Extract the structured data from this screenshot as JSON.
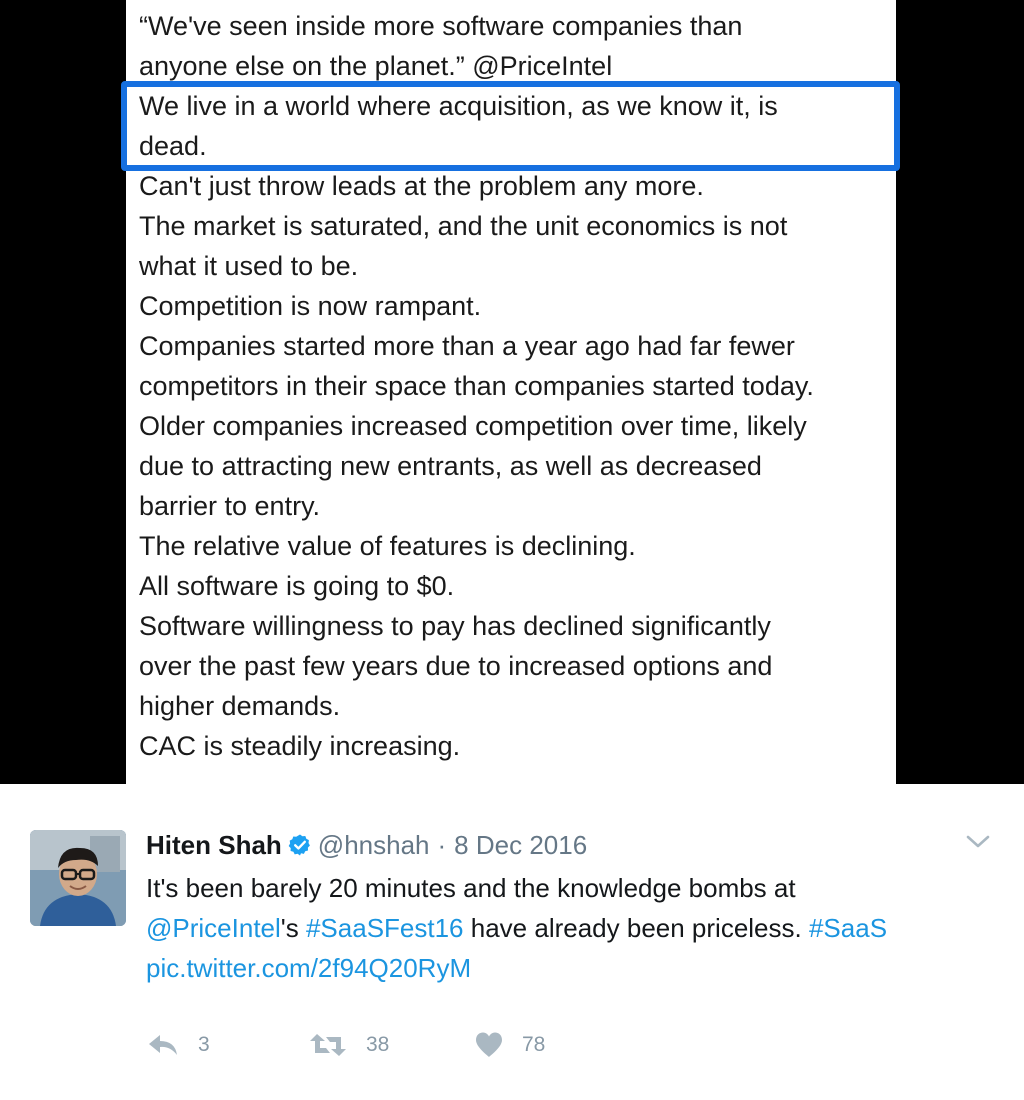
{
  "image": {
    "lines": [
      "“We've seen inside more software companies than",
      "anyone else on the planet.” @PriceIntel",
      "We live in a world where acquisition, as we know it, is",
      "dead.",
      "Can't just throw leads at the problem any more.",
      "The market is saturated, and the unit economics is not",
      "what it used to be.",
      "Competition is now rampant.",
      "Companies started more than a year ago had far fewer",
      "competitors in their space than companies started today.",
      "Older companies increased competition over time, likely",
      "due to attracting new entrants, as well as decreased",
      "barrier to entry.",
      "The relative value of features is declining.",
      "All software is going to $0.",
      "Software willingness to pay has declined significantly",
      "over the past few years due to increased options and",
      "higher demands.",
      "CAC is steadily increasing."
    ],
    "highlight_color": "#1670e0"
  },
  "tweet": {
    "author_name": "Hiten Shah",
    "handle": "@hnshah",
    "separator": "·",
    "date": "8 Dec 2016",
    "text": {
      "l1": "It's been barely 20 minutes and the knowledge bombs at",
      "mention": "@PriceIntel",
      "l2_mid": "'s ",
      "hashtag1": "#SaaSFest16",
      "l2_tail": " have already been priceless. ",
      "hashtag2": "#SaaS",
      "pic_link": "pic.twitter.com/2f94Q20RyM"
    },
    "actions": {
      "replies": "3",
      "retweets": "38",
      "likes": "78"
    },
    "icons": [
      "verified-badge-icon",
      "chevron-down-icon",
      "reply-icon",
      "retweet-icon",
      "heart-icon"
    ],
    "colors": {
      "link": "#1b95e0",
      "verified": "#1da1f2",
      "muted": "#657786",
      "action": "#aab8c2"
    }
  }
}
